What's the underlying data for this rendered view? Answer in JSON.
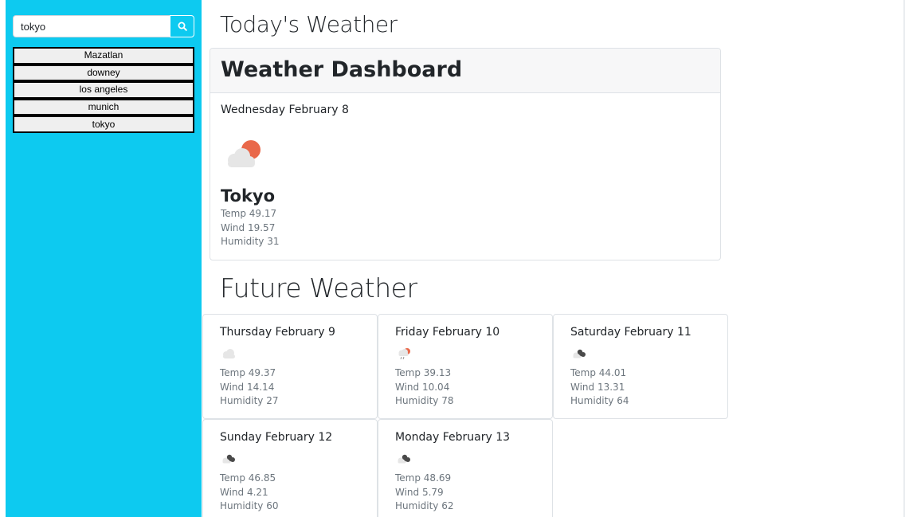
{
  "search": {
    "value": "tokyo",
    "placeholder": ""
  },
  "search_icon": "search-icon",
  "history": [
    "Mazatlan",
    "downey",
    "los angeles",
    "munich",
    "tokyo"
  ],
  "colors": {
    "sidebar": "#0dcaf0",
    "sun": "#e9684a",
    "cloud": "#e6e6e6",
    "dark_cloud": "#4a4a4a"
  },
  "today": {
    "section_title": "Today's Weather",
    "card_title": "Weather Dashboard",
    "date": "Wednesday February 8",
    "icon": "partly-cloudy-day-icon",
    "city": "Tokyo",
    "temp": "Temp 49.17",
    "wind": "Wind 19.57",
    "humidity": "Humidity 31"
  },
  "future": {
    "section_title": "Future Weather",
    "days": [
      {
        "date": "Thursday February 9",
        "icon": "cloud-icon",
        "temp": "Temp 49.37",
        "wind": "Wind 14.14",
        "humidity": "Humidity 27"
      },
      {
        "date": "Friday February 10",
        "icon": "rain-sun-icon",
        "temp": "Temp 39.13",
        "wind": "Wind 10.04",
        "humidity": "Humidity 78"
      },
      {
        "date": "Saturday February 11",
        "icon": "broken-clouds-icon",
        "temp": "Temp 44.01",
        "wind": "Wind 13.31",
        "humidity": "Humidity 64"
      },
      {
        "date": "Sunday February 12",
        "icon": "broken-clouds-icon",
        "temp": "Temp 46.85",
        "wind": "Wind 4.21",
        "humidity": "Humidity 60"
      },
      {
        "date": "Monday February 13",
        "icon": "broken-clouds-icon",
        "temp": "Temp 48.69",
        "wind": "Wind 5.79",
        "humidity": "Humidity 62"
      }
    ]
  }
}
